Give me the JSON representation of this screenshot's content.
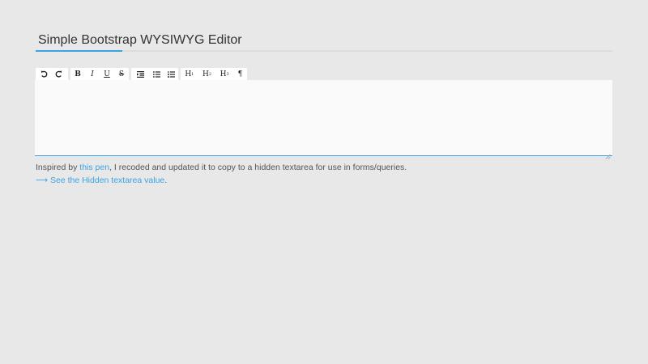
{
  "header": {
    "title": "Simple Bootstrap WYSIWYG Editor"
  },
  "toolbar": {
    "undo_icon": "undo-icon",
    "redo_icon": "redo-icon",
    "bold_label": "B",
    "italic_label": "I",
    "underline_label": "U",
    "strike_label": "S",
    "indent_icon": "indent-icon",
    "bullet_list_icon": "bullet-list-icon",
    "numbered_list_icon": "numbered-list-icon",
    "h1_label": "H",
    "h1_sup": "1",
    "h2_label": "H",
    "h2_sup": "2",
    "h3_label": "H",
    "h3_sup": "3",
    "paragraph_label": "¶"
  },
  "editor": {
    "content": ""
  },
  "footer": {
    "desc_prefix": "Inspired by ",
    "desc_link": "this pen",
    "desc_suffix": ", I recoded and updated it to copy to a hidden textarea for use in forms/queries.",
    "see_arrow": "⟶",
    "see_link": "See the Hidden textarea value",
    "see_suffix": "."
  },
  "colors": {
    "accent": "#3aa3e3",
    "background": "#e8e8e8",
    "editor_bg": "#fafafa"
  }
}
